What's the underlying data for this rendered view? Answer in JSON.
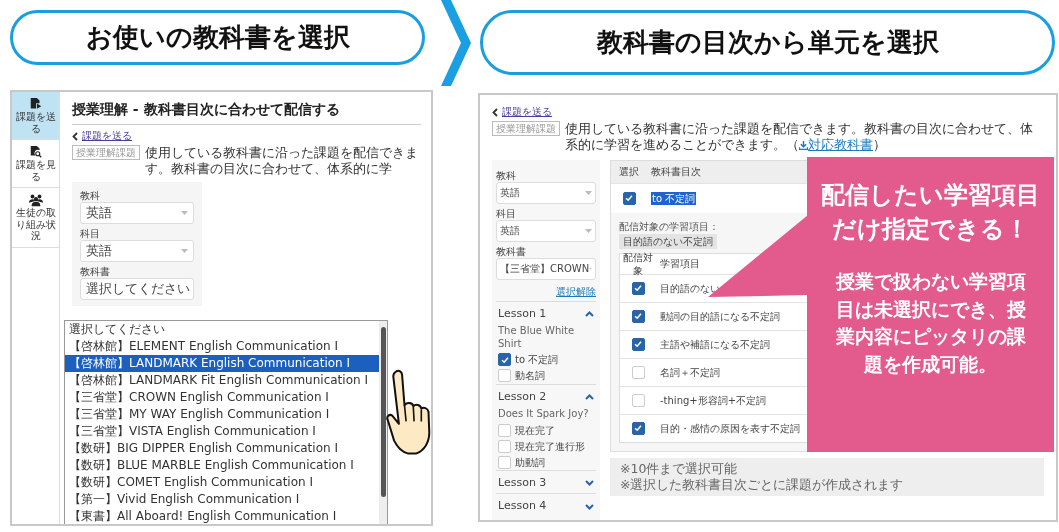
{
  "headings": [
    {
      "text": "お使いの教科書を選択"
    },
    {
      "text": "教科書の目次から単元を選択"
    }
  ],
  "left_screen": {
    "sidebar": [
      {
        "label": "課題を送る",
        "selected": true,
        "kind": "send"
      },
      {
        "label": "課題を見る",
        "selected": false,
        "kind": "view"
      },
      {
        "label": "生徒の取り組み状況",
        "selected": false,
        "kind": "students"
      }
    ],
    "title": "授業理解 - 教科書目次に合わせて配信する",
    "back_link": "課題を送る",
    "tag": "授業理解課題",
    "description": "使用している教科書に沿った課題を配信できます。教科書の目次に合わせて、体系的に学",
    "fields": [
      {
        "label": "教科",
        "value": "英語"
      },
      {
        "label": "科目",
        "value": "英語"
      },
      {
        "label": "教科書",
        "value": "選択してください"
      }
    ],
    "dropdown": [
      {
        "text": "選択してください",
        "selected": false
      },
      {
        "text": "【啓林館】ELEMENT English Communication Ⅰ",
        "selected": false
      },
      {
        "text": "【啓林館】LANDMARK English Communication Ⅰ",
        "selected": true
      },
      {
        "text": "【啓林館】LANDMARK Fit English Communication Ⅰ",
        "selected": false
      },
      {
        "text": "【三省堂】CROWN English Communication Ⅰ",
        "selected": false
      },
      {
        "text": "【三省堂】MY WAY English Communication Ⅰ",
        "selected": false
      },
      {
        "text": "【三省堂】VISTA English Communication Ⅰ",
        "selected": false
      },
      {
        "text": "【数研】BIG DIPPER English Communication Ⅰ",
        "selected": false
      },
      {
        "text": "【数研】BLUE MARBLE English Communication Ⅰ",
        "selected": false
      },
      {
        "text": "【数研】COMET English Communication Ⅰ",
        "selected": false
      },
      {
        "text": "【第一】Vivid English Communication Ⅰ",
        "selected": false
      },
      {
        "text": "【東書】All Aboard! English Communication Ⅰ",
        "selected": false
      }
    ]
  },
  "right_screen": {
    "back_link": "課題を送る",
    "tag": "授業理解課題",
    "description": "使用している教科書に沿った課題を配信できます。教科書の目次に合わせて、体系的に学習を進めることができます。（",
    "link": "対応教科書",
    "description_end": "）",
    "fields": [
      {
        "label": "教科",
        "value": "英語"
      },
      {
        "label": "科目",
        "value": "英語"
      },
      {
        "label": "教科書",
        "value": "【三省堂】CROWN"
      }
    ],
    "clear_link": "選択解除",
    "lessons": [
      {
        "title": "Lesson 1",
        "expanded": true,
        "subtitle": "The Blue White Shirt",
        "items": [
          {
            "label": "to 不定詞",
            "checked": true
          },
          {
            "label": "動名詞",
            "checked": false
          }
        ]
      },
      {
        "title": "Lesson 2",
        "expanded": true,
        "subtitle": "Does It Spark Joy?",
        "items": [
          {
            "label": "現在完了",
            "checked": false
          },
          {
            "label": "現在完了進行形",
            "checked": false
          },
          {
            "label": "助動詞",
            "checked": false
          }
        ]
      },
      {
        "title": "Lesson 3",
        "expanded": false
      },
      {
        "title": "Lesson 4",
        "expanded": false
      }
    ],
    "toc_table": {
      "columns": [
        "選択",
        "教科書目次"
      ],
      "rows": [
        {
          "checked": true,
          "text": "to 不定詞",
          "highlighted": true
        }
      ]
    },
    "target_label": "配信対象の学習項目：",
    "target_chip": "目的語のない不定詞",
    "items_table": {
      "columns": [
        "配信対象",
        "学習項目"
      ],
      "rows": [
        {
          "checked": true,
          "text": "目的語のない"
        },
        {
          "checked": true,
          "text": "動詞の目的語になる不定詞"
        },
        {
          "checked": true,
          "text": "主語や補語になる不定詞"
        },
        {
          "checked": false,
          "text": "名詞＋不定詞"
        },
        {
          "checked": false,
          "text": "-thing+形容詞+不定詞"
        },
        {
          "checked": true,
          "text": "目的・感情の原因を表す不定詞"
        }
      ]
    },
    "notes": [
      "※10件まで選択可能",
      "※選択した教科書目次ごとに課題が作成されます"
    ]
  },
  "callout": {
    "headline": "配信したい学習項目だけ指定できる！",
    "text": "授業で扱わない学習項目は未選択にでき、授業内容にピッタリの課題を作成可能。"
  }
}
